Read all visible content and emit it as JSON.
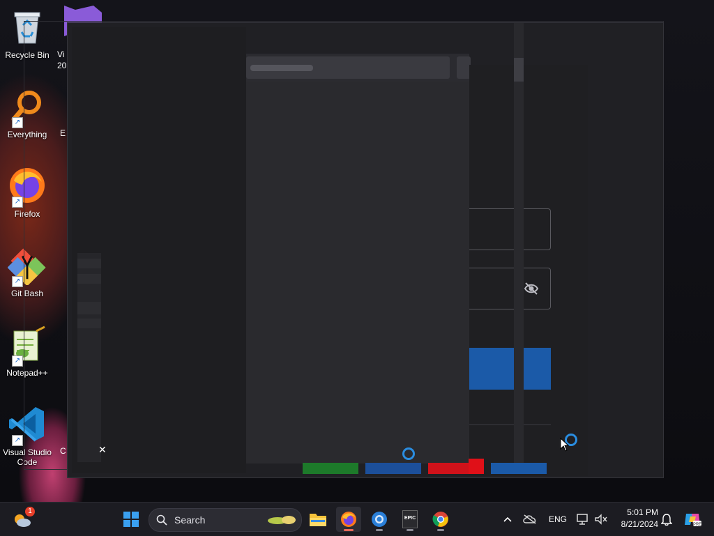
{
  "desktop": {
    "icons": [
      {
        "label": "Recycle Bin"
      },
      {
        "label": "Everything"
      },
      {
        "label": "Firefox"
      },
      {
        "label": "Git Bash"
      },
      {
        "label": "Notepad++"
      },
      {
        "label": "Visual Studio Code"
      }
    ],
    "partial_labels": [
      "Vi",
      "20",
      "E",
      "C"
    ]
  },
  "taskbar": {
    "search_label": "Search",
    "weather_badge": "1",
    "language": "ENG",
    "time": "5:01 PM",
    "date": "8/21/2024",
    "pinned": [
      "start-button",
      "file-explorer",
      "firefox",
      "browser-blue",
      "epic-games",
      "chrome"
    ],
    "epic_label": "EPIC"
  },
  "colors": {
    "accent_blue": "#1b5aa8",
    "spinner_blue": "#2a8de0",
    "window_bg": "#202024"
  }
}
